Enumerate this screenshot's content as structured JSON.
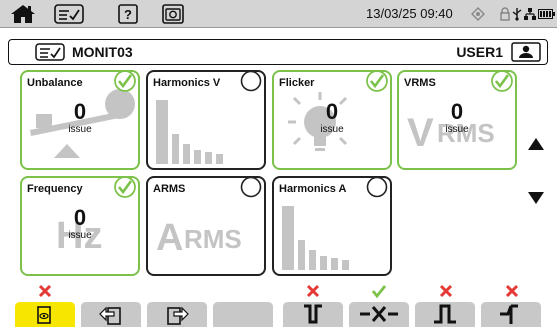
{
  "statusbar": {
    "datetime": "13/03/25 09:40",
    "icons": [
      "home-icon",
      "checklist-icon",
      "help-icon",
      "camera-icon",
      "sensor-icon",
      "lock-icon",
      "usb-icon",
      "network-icon",
      "battery-icon"
    ]
  },
  "header": {
    "device_name": "MONIT03",
    "user": "USER1",
    "icons": [
      "checklist-icon",
      "user-icon"
    ]
  },
  "tiles": [
    {
      "title": "Unbalance",
      "count": "0",
      "unit": "issue",
      "status": "ok",
      "icon": "unbalance-icon"
    },
    {
      "title": "Harmonics V",
      "count": "",
      "unit": "",
      "status": "empty",
      "icon": "harmonics-bars-icon"
    },
    {
      "title": "Flicker",
      "count": "0",
      "unit": "issue",
      "status": "ok",
      "icon": "bulb-icon"
    },
    {
      "title": "VRMS",
      "count": "0",
      "unit": "issue",
      "status": "ok",
      "icon": "vrms-icon",
      "art_text": "VRMS"
    },
    {
      "title": "Frequency",
      "count": "0",
      "unit": "issue",
      "status": "ok",
      "icon": "hz-icon",
      "art_text": "Hz"
    },
    {
      "title": "ARMS",
      "count": "",
      "unit": "",
      "status": "empty",
      "icon": "arms-icon",
      "art_text": "ARMS"
    },
    {
      "title": "Harmonics A",
      "count": "",
      "unit": "",
      "status": "empty",
      "icon": "harmonics-bars-icon"
    }
  ],
  "navigation": {
    "up": "up-arrow-icon",
    "down": "down-arrow-icon"
  },
  "bottombar": {
    "keys": [
      {
        "icon": "view-icon",
        "active": true,
        "mark": "fail"
      },
      {
        "icon": "import-icon",
        "active": false,
        "mark": ""
      },
      {
        "icon": "export-icon",
        "active": false,
        "mark": ""
      },
      {
        "icon": "blank",
        "active": false,
        "mark": ""
      },
      {
        "icon": "voltage-dip-icon",
        "active": false,
        "mark": "fail"
      },
      {
        "icon": "interruption-icon",
        "active": false,
        "mark": "ok"
      },
      {
        "icon": "swell-icon",
        "active": false,
        "mark": "fail"
      },
      {
        "icon": "transient-icon",
        "active": false,
        "mark": "fail"
      }
    ]
  },
  "colors": {
    "ok_green": "#7cc24a",
    "fail_red": "#e53935",
    "active_yellow": "#f7e600",
    "inactive_key": "#c8c8c8",
    "art_grey": "#c4c4c4"
  }
}
